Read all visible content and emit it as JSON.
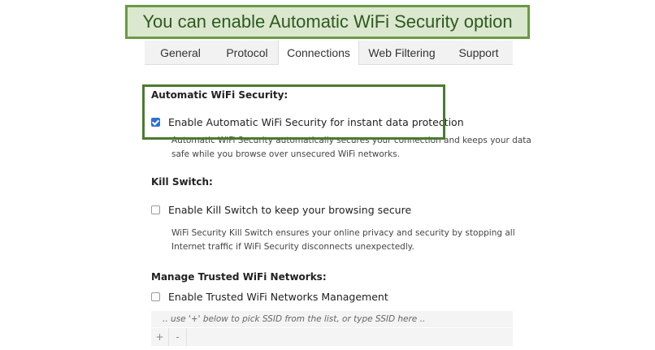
{
  "banner": {
    "text": "You can enable Automatic WiFi Security option"
  },
  "tabs": [
    {
      "label": "General",
      "active": false
    },
    {
      "label": "Protocol",
      "active": false
    },
    {
      "label": "Connections",
      "active": true
    },
    {
      "label": "Web Filtering",
      "active": false
    },
    {
      "label": "Support",
      "active": false
    }
  ],
  "automatic_wifi": {
    "title": "Automatic WiFi Security:",
    "checkbox_label": "Enable Automatic WiFi Security for instant data protection",
    "checked": true,
    "description_line1": "Automatic WiFi Security automatically secures your connection and keeps your data",
    "description_line2": "safe while you browse over unsecured WiFi networks."
  },
  "kill_switch": {
    "title": "Kill Switch:",
    "checkbox_label": "Enable Kill Switch to keep your browsing secure",
    "checked": false,
    "description_line1": "WiFi Security Kill Switch ensures your online privacy and security by stopping all",
    "description_line2": "Internet traffic if WiFi Security disconnects unexpectedly."
  },
  "trusted_networks": {
    "title": "Manage Trusted WiFi Networks:",
    "checkbox_label": "Enable Trusted WiFi Networks Management",
    "checked": false,
    "ssid_placeholder": ".. use '+' below to pick SSID from the list, or type SSID here ..",
    "add_label": "+",
    "remove_label": "-"
  },
  "colors": {
    "banner_bg": "#dbe8cf",
    "banner_border": "#6a9a45",
    "highlight_border": "#4a7a2e",
    "checkbox_checked": "#2f6fd6"
  }
}
